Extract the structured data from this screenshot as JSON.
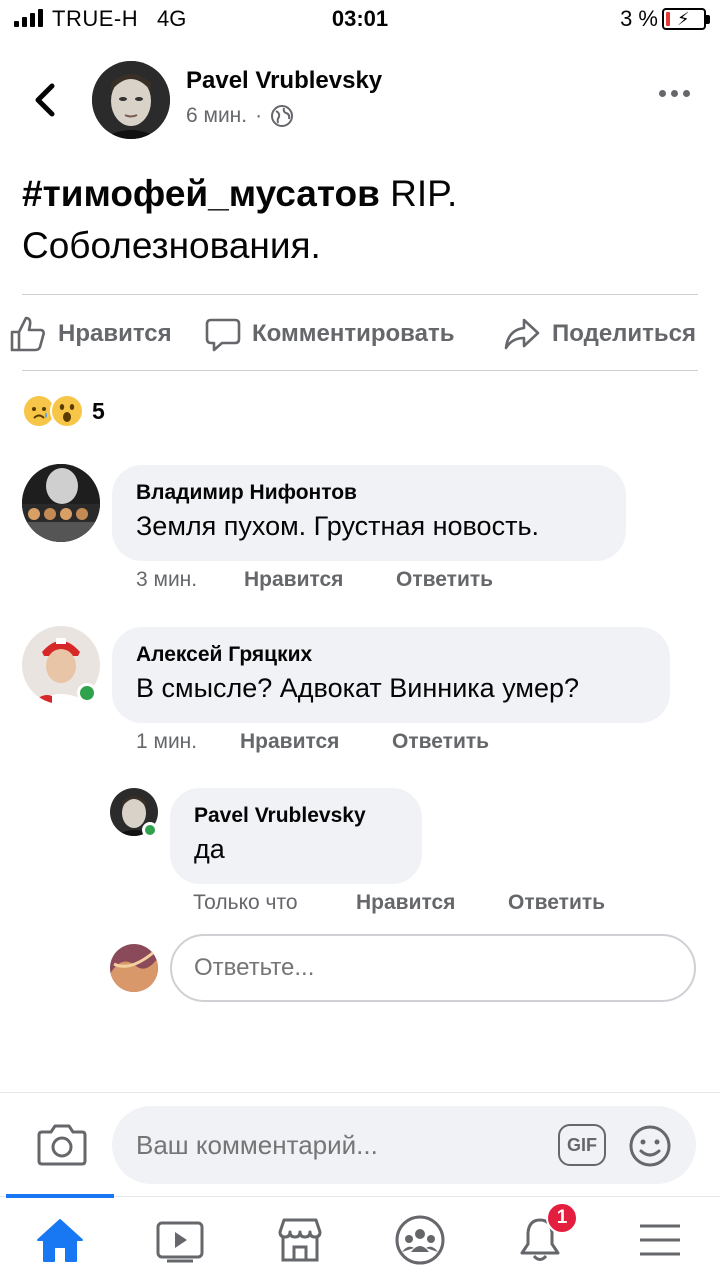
{
  "status_bar": {
    "carrier": "TRUE-H",
    "network": "4G",
    "time": "03:01",
    "battery": "3 %"
  },
  "post": {
    "author": "Pavel Vrublevsky",
    "time": "6 мин.",
    "separator": "·",
    "privacy_icon": "globe-icon",
    "hashtag": "#тимофей_мусатов",
    "text": " RIP. Соболезнования."
  },
  "actions": {
    "like": "Нравится",
    "comment": "Комментировать",
    "share": "Поделиться"
  },
  "reactions": {
    "icons": [
      "sad-reaction-icon",
      "wow-reaction-icon"
    ],
    "count": "5"
  },
  "comments": [
    {
      "name": "Владимир Нифонтов",
      "text": "Земля пухом. Грустная новость.",
      "time": "3 мин.",
      "like": "Нравится",
      "reply": "Ответить"
    },
    {
      "name": "Алексей Гряцких",
      "text": "В смысле? Адвокат Винника умер?",
      "time": "1 мин.",
      "like": "Нравится",
      "reply": "Ответить"
    }
  ],
  "reply": {
    "name": "Pavel Vrublevsky",
    "text": "да",
    "time": "Только что",
    "like": "Нравится",
    "reply": "Ответить"
  },
  "reply_input": {
    "placeholder": "Ответьте..."
  },
  "composer": {
    "placeholder": "Ваш комментарий...",
    "gif": "GIF"
  },
  "tabbar": {
    "tabs": [
      "home-icon",
      "video-icon",
      "marketplace-icon",
      "groups-icon",
      "notifications-icon",
      "menu-icon"
    ],
    "notification_badge": "1",
    "active_color": "#1877f2"
  }
}
